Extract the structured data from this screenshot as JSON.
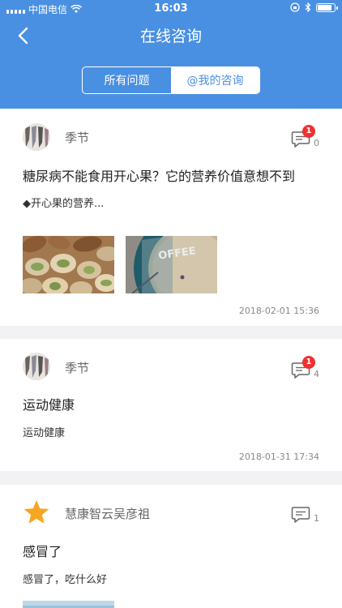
{
  "status_bar": {
    "carrier": "中国电信",
    "time": "16:03"
  },
  "nav": {
    "title": "在线咨询",
    "back_icon": "chevron-left-icon"
  },
  "segment": {
    "tabs": [
      "所有问题",
      "@我的咨询"
    ],
    "active": "@我的咨询"
  },
  "colors": {
    "primary": "#4a90e2",
    "badge": "#f0312f",
    "background": "#f2f2f5"
  },
  "questions": [
    {
      "author": "季节",
      "title": "糖尿病不能食用开心果？它的营养价值意想不到",
      "desc": "◆开心果的营养...",
      "badge": "1",
      "comment_count": "0",
      "time": "2018-02-01 15:36",
      "images": [
        "pistachio-photo",
        "coffee-sign-photo"
      ]
    },
    {
      "author": "季节",
      "title": "运动健康",
      "desc": "运动健康",
      "badge": "1",
      "comment_count": "4",
      "time": "2018-01-31 17:34"
    },
    {
      "author": "慧康智云吴彦祖",
      "title": "感冒了",
      "desc": "感冒了，吃什么好",
      "comment_count": "1",
      "avatar_icon": "star-icon"
    }
  ]
}
